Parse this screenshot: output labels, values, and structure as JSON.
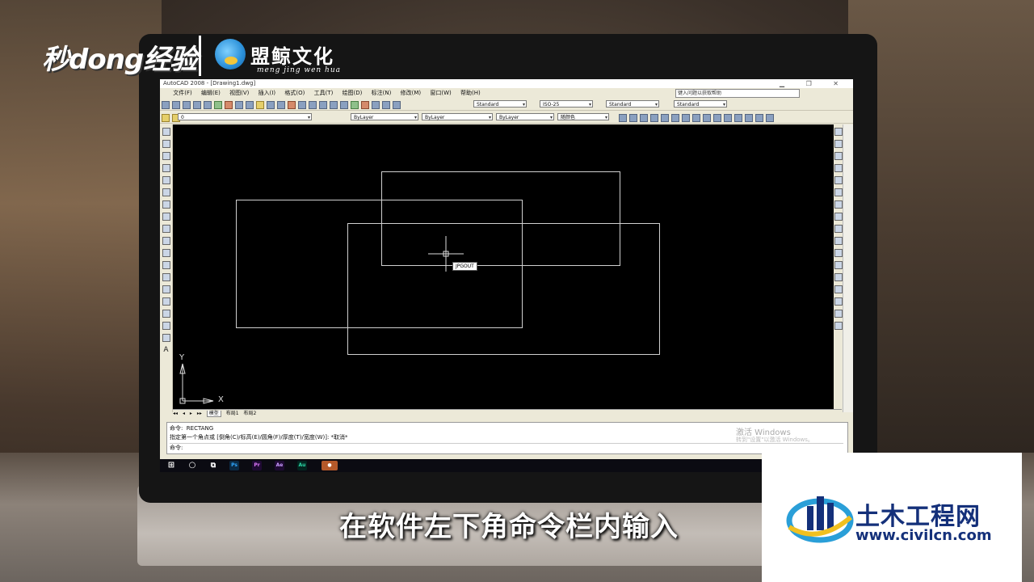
{
  "overlay": {
    "brand_left": "秒dong经验",
    "brand_right": "盟鲸文化",
    "brand_right_pinyin": "meng jing wen hua",
    "subtitle": "在软件左下角命令栏内输入",
    "watermark_title": "土木工程网",
    "watermark_url": "www.civilcn.com"
  },
  "window": {
    "title": "AutoCAD 2008 - [Drawing1.dwg]",
    "controls": "▁ ❐ ✕"
  },
  "menu": {
    "items": [
      "文件(F)",
      "编辑(E)",
      "视图(V)",
      "插入(I)",
      "格式(O)",
      "工具(T)",
      "绘图(D)",
      "标注(N)",
      "修改(M)",
      "窗口(W)",
      "帮助(H)"
    ],
    "help_search": "键入问题以获取帮助"
  },
  "toolbar": {
    "text_style": "Standard",
    "dim_style": "ISO-25",
    "table_style": "Standard",
    "multileader_style": "Standard",
    "layer": "0",
    "color": "ByLayer",
    "linetype": "ByLayer",
    "lineweight": "ByLayer",
    "plot_style": "随颜色"
  },
  "left_toolbar_text": "A",
  "canvas": {
    "tooltip": "JPGOUT",
    "axis_x": "X",
    "axis_y": "Y"
  },
  "layout_tabs": [
    "◂◂",
    "◂",
    "▸",
    "▸▸",
    "模型",
    "布局1",
    "布局2"
  ],
  "command": {
    "line1": "命令:  RECTANG",
    "line2": "指定第一个角点或 [倒角(C)/标高(E)/圆角(F)/厚度(T)/宽度(W)]: *取消*",
    "line3": "命令:",
    "activate_title": "激活 Windows",
    "activate_sub": "转到\"设置\"以激活 Windows。"
  },
  "taskbar": {
    "apps": [
      "Ps",
      "Pr",
      "Ae",
      "Au"
    ]
  },
  "colors": {
    "canvas": "#000000",
    "watermark_blue": "#14307a"
  }
}
